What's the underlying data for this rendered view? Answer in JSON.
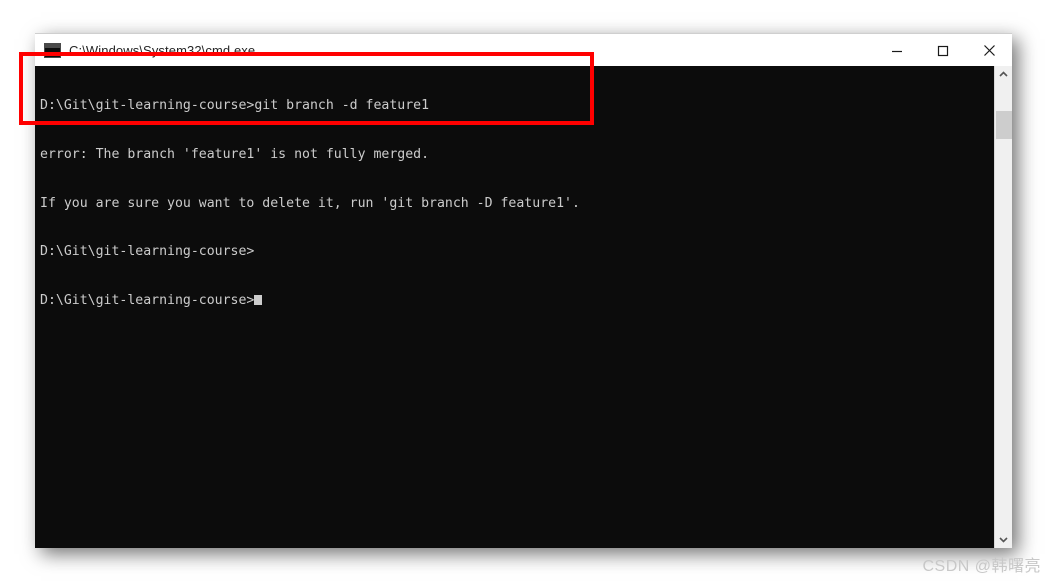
{
  "window": {
    "title": "C:\\Windows\\System32\\cmd.exe",
    "icon": "console-window-icon",
    "controls": {
      "minimize_label": "Minimize",
      "maximize_label": "Maximize",
      "close_label": "Close"
    }
  },
  "console": {
    "background_color": "#0c0c0c",
    "text_color": "#cccccc",
    "lines": [
      "D:\\Git\\git-learning-course>git branch -d feature1",
      "error: The branch 'feature1' is not fully merged.",
      "If you are sure you want to delete it, run 'git branch -D feature1'.",
      "D:\\Git\\git-learning-course>",
      "D:\\Git\\git-learning-course>"
    ],
    "cursor_visible": true
  },
  "scrollbar": {
    "up_arrow": "chevron-up-icon",
    "down_arrow": "chevron-down-icon",
    "thumb_color": "#cdcdcd",
    "track_color": "#f0f0f0"
  },
  "annotation": {
    "color": "#ff0000",
    "shape": "rectangle",
    "highlights_lines": 3
  },
  "watermark": {
    "text": "CSDN @韩曙亮",
    "color": "#c8c8c8"
  }
}
